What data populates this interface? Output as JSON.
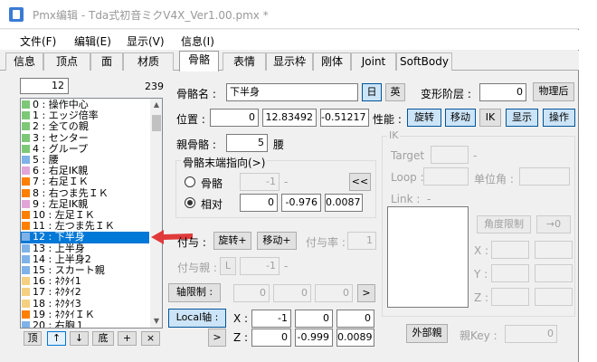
{
  "window": {
    "title": "Pmx编辑 - Tda式初音ミクV4X_Ver1.00.pmx *"
  },
  "menu": [
    "文件(F)",
    "编辑(E)",
    "显示(V)",
    "信息(I)"
  ],
  "tabs": [
    "信息",
    "顶点",
    "面",
    "材质",
    "骨骼",
    "表情",
    "显示枠",
    "刚体",
    "Joint",
    "SoftBody"
  ],
  "active_tab": "骨骼",
  "list": {
    "index_value": "12",
    "count": "239",
    "items": [
      {
        "label": "0 : 操作中心",
        "color": "#7dc877"
      },
      {
        "label": "1 : エッジ倍率",
        "color": "#7dc877"
      },
      {
        "label": "2 : 全ての親",
        "color": "#7dc877"
      },
      {
        "label": "3 : センター",
        "color": "#7dc877"
      },
      {
        "label": "4 : グループ",
        "color": "#7dc877"
      },
      {
        "label": "5 : 腰",
        "color": "#7fb2e8"
      },
      {
        "label": "6 : 右足IK親",
        "color": "#e1a5d8"
      },
      {
        "label": "7 : 右足ＩＫ",
        "color": "#ff7f00"
      },
      {
        "label": "8 : 右つま先ＩＫ",
        "color": "#ff7f00"
      },
      {
        "label": "9 : 左足IK親",
        "color": "#e1a5d8"
      },
      {
        "label": "10 : 左足ＩＫ",
        "color": "#ff7f00"
      },
      {
        "label": "11 : 左つま先ＩＫ",
        "color": "#ff7f00"
      },
      {
        "label": "12 : 下半身",
        "color": "#7fb2e8"
      },
      {
        "label": "13 : 上半身",
        "color": "#7fb2e8"
      },
      {
        "label": "14 : 上半身2",
        "color": "#7fb2e8"
      },
      {
        "label": "15 : スカート親",
        "color": "#7fb2e8"
      },
      {
        "label": "16 : ﾈｸﾀｲ1",
        "color": "#f5d080"
      },
      {
        "label": "17 : ﾈｸﾀｲ2",
        "color": "#f5d080"
      },
      {
        "label": "18 : ﾈｸﾀｲ3",
        "color": "#f5d080"
      },
      {
        "label": "19 : ﾈｸﾀｲＩＫ",
        "color": "#ff7f00"
      },
      {
        "label": "20 : 右胸１",
        "color": "#7fb2e8"
      }
    ],
    "selected_index": 12,
    "buttons": [
      "顶",
      "↑",
      "↓",
      "底",
      "+",
      "×"
    ]
  },
  "bone": {
    "name_label": "骨骼名 :",
    "name": "下半身",
    "lang_jp": "日",
    "lang_en": "英",
    "layer_label": "变形阶层 :",
    "layer": "0",
    "after_physics": "物理后",
    "pos_label": "位置 :",
    "pos": [
      "0",
      "12.83492",
      "-0.51217"
    ],
    "perf_label": "性能 :",
    "perf": [
      "旋转",
      "移动",
      "IK",
      "显示",
      "操作"
    ],
    "parent_label": "親骨骼 :",
    "parent_idx": "5",
    "parent_name": "腰",
    "tip_legend": "骨骼末端指向(>)",
    "tip_bone_label": "骨骼",
    "tip_bone_val": "-1",
    "tip_bone_dash": "-",
    "tip_btn": "<<",
    "tip_rel_label": "相对",
    "tip_rel": [
      "0",
      "-0.976",
      "0.0087"
    ],
    "grant_label": "付与 :",
    "grant_rot": "旋转+",
    "grant_move": "移动+",
    "grant_rate_label": "付与率 :",
    "grant_rate": "1",
    "grant_parent_label": "付与親 :",
    "grant_parent_btn": "L",
    "grant_parent_val": "-1",
    "grant_parent_dash": "-",
    "axis_label": "轴限制 :",
    "axis": [
      "0",
      "0",
      "0"
    ],
    "axis_btn": ">",
    "local_label": "Local轴 :",
    "local_x_lbl": "X :",
    "local_x": [
      "-1",
      "0",
      "0"
    ],
    "local_z_lbl": "Z :",
    "local_z": [
      "0",
      "-0.999",
      "0.0089"
    ],
    "local_btn": ">",
    "ext_parent": "外部親",
    "key_label": "親Key :",
    "key_val": "0"
  },
  "ik": {
    "legend": "IK",
    "target_label": "Target",
    "target_dash": "-",
    "loop_label": "Loop :",
    "unit_label": "单位角 :",
    "link_label": "Link :",
    "link_dash": "-",
    "angle_btn": "角度限制",
    "zero_btn": "→0",
    "x": "X :",
    "y": "Y :",
    "z": "Z :"
  }
}
